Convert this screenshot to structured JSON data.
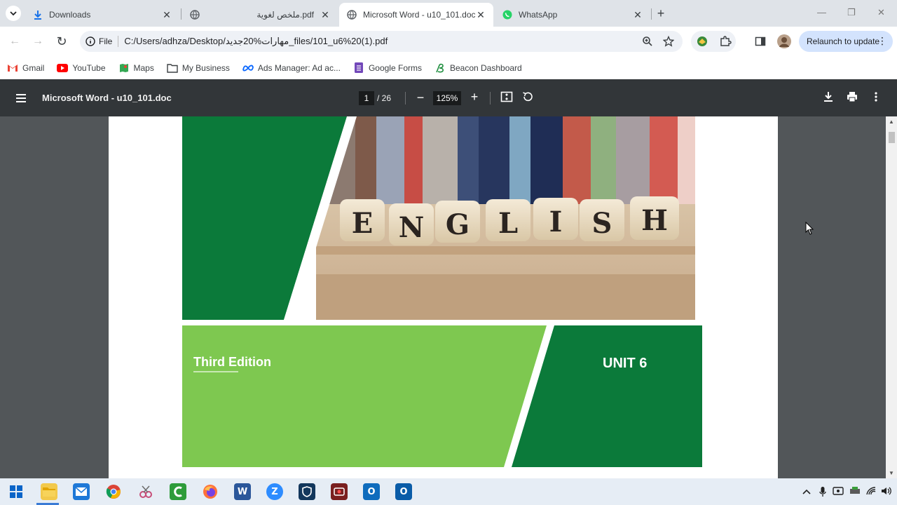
{
  "tabs": [
    {
      "title": "Downloads",
      "icon": "download-icon"
    },
    {
      "title": "ملخص لغوية.pdf",
      "icon": "globe-icon"
    },
    {
      "title": "Microsoft Word - u10_101.doc",
      "icon": "globe-icon",
      "active": true
    },
    {
      "title": "WhatsApp",
      "icon": "whatsapp-icon"
    }
  ],
  "omnibox": {
    "scheme_label": "File",
    "url": "C:/Users/adhza/Desktop/مهارات%20جديد_files/101_u6%20(1).pdf"
  },
  "relaunch_label": "Relaunch to update",
  "bookmarks": [
    {
      "label": "Gmail",
      "icon": "gmail-icon"
    },
    {
      "label": "YouTube",
      "icon": "youtube-icon"
    },
    {
      "label": "Maps",
      "icon": "maps-icon"
    },
    {
      "label": "My Business",
      "icon": "folder-icon"
    },
    {
      "label": "Ads Manager: Ad ac...",
      "icon": "meta-icon"
    },
    {
      "label": "Google Forms",
      "icon": "forms-icon"
    },
    {
      "label": "Beacon Dashboard",
      "icon": "beacon-icon"
    }
  ],
  "pdf": {
    "title": "Microsoft Word - u10_101.doc",
    "page_current": "1",
    "page_total": "/ 26",
    "zoom": "125%"
  },
  "cover": {
    "blocks": [
      "E",
      "N",
      "G",
      "L",
      "I",
      "S",
      "H"
    ],
    "edition": "Third Edition",
    "unit": "UNIT 6",
    "colors": {
      "dark_green": "#0b7a3a",
      "light_green": "#7ec850"
    }
  },
  "taskbar_apps": [
    "start",
    "file-explorer",
    "mail",
    "chrome",
    "snipping-tool",
    "camtasia",
    "firefox",
    "word",
    "zoom",
    "vpn",
    "recorder",
    "outlook-new",
    "outlook"
  ]
}
